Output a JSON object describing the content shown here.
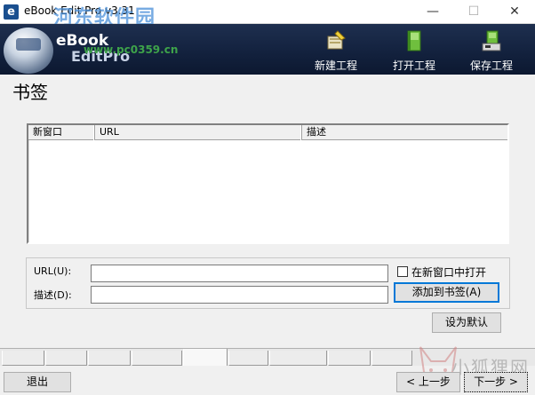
{
  "window": {
    "title": "eBook Edit Pro v3.31",
    "minimize_glyph": "—",
    "maximize_glyph": "☐",
    "close_glyph": "✕"
  },
  "banner": {
    "logo_line1": "eBook",
    "logo_line2": "EditPro",
    "watermark_title": "河东软件园",
    "watermark_url": "www.pc0359.cn",
    "tools": [
      {
        "label": "新建工程",
        "icon": "new-project-icon"
      },
      {
        "label": "打开工程",
        "icon": "open-project-icon"
      },
      {
        "label": "保存工程",
        "icon": "save-project-icon"
      }
    ]
  },
  "page": {
    "title": "书签"
  },
  "bookmark_table": {
    "columns": [
      "新窗口",
      "URL",
      "描述"
    ],
    "rows": []
  },
  "form": {
    "url_label": "URL(U):",
    "url_value": "",
    "desc_label": "描述(D):",
    "desc_value": "",
    "open_new_window_label": "在新窗口中打开",
    "open_new_window_checked": false,
    "add_button": "添加到书签(A)",
    "default_button": "设为默认"
  },
  "footer": {
    "exit_button": "退出",
    "prev_button": "< 上一步",
    "next_button": "下一步 >",
    "watermark": "小狐狸网"
  },
  "colors": {
    "banner_dark": "#142340",
    "accent_blue": "#0078d7",
    "watermark_green": "#3ea34a"
  }
}
